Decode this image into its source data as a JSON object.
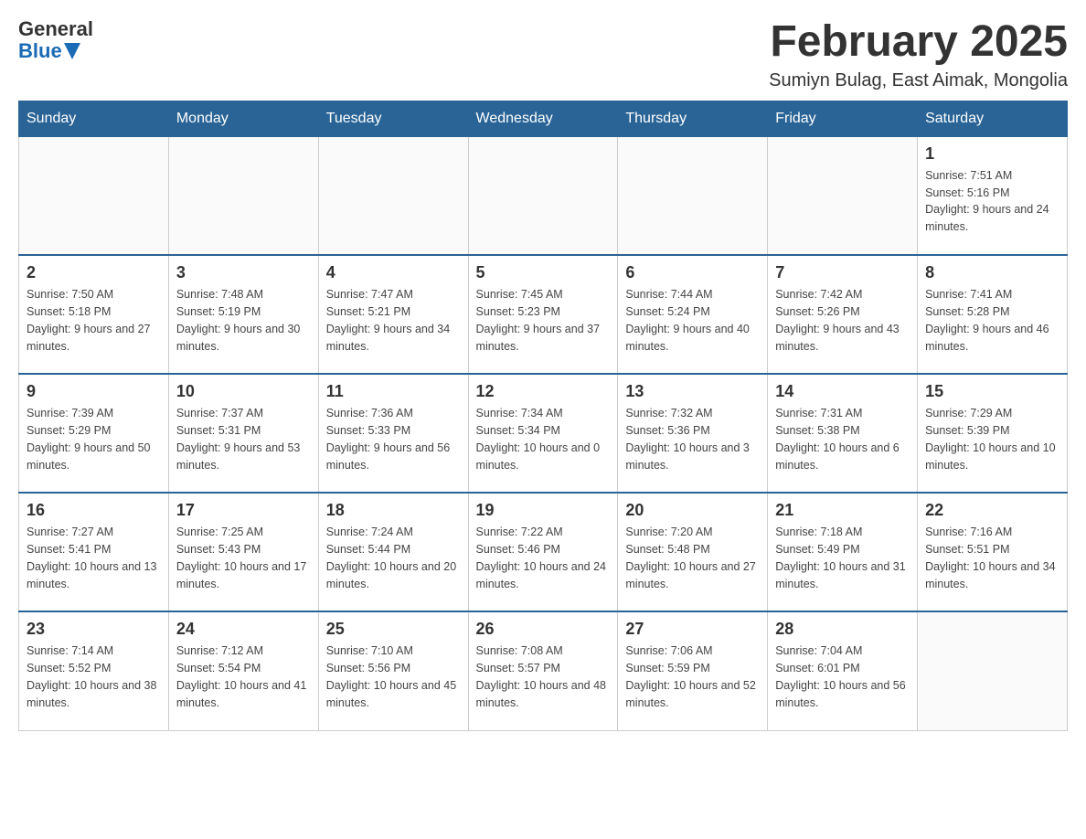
{
  "header": {
    "logo_general": "General",
    "logo_blue": "Blue",
    "title": "February 2025",
    "location": "Sumiyn Bulag, East Aimak, Mongolia"
  },
  "weekdays": [
    "Sunday",
    "Monday",
    "Tuesday",
    "Wednesday",
    "Thursday",
    "Friday",
    "Saturday"
  ],
  "weeks": [
    [
      {
        "day": "",
        "info": ""
      },
      {
        "day": "",
        "info": ""
      },
      {
        "day": "",
        "info": ""
      },
      {
        "day": "",
        "info": ""
      },
      {
        "day": "",
        "info": ""
      },
      {
        "day": "",
        "info": ""
      },
      {
        "day": "1",
        "info": "Sunrise: 7:51 AM\nSunset: 5:16 PM\nDaylight: 9 hours and 24 minutes."
      }
    ],
    [
      {
        "day": "2",
        "info": "Sunrise: 7:50 AM\nSunset: 5:18 PM\nDaylight: 9 hours and 27 minutes."
      },
      {
        "day": "3",
        "info": "Sunrise: 7:48 AM\nSunset: 5:19 PM\nDaylight: 9 hours and 30 minutes."
      },
      {
        "day": "4",
        "info": "Sunrise: 7:47 AM\nSunset: 5:21 PM\nDaylight: 9 hours and 34 minutes."
      },
      {
        "day": "5",
        "info": "Sunrise: 7:45 AM\nSunset: 5:23 PM\nDaylight: 9 hours and 37 minutes."
      },
      {
        "day": "6",
        "info": "Sunrise: 7:44 AM\nSunset: 5:24 PM\nDaylight: 9 hours and 40 minutes."
      },
      {
        "day": "7",
        "info": "Sunrise: 7:42 AM\nSunset: 5:26 PM\nDaylight: 9 hours and 43 minutes."
      },
      {
        "day": "8",
        "info": "Sunrise: 7:41 AM\nSunset: 5:28 PM\nDaylight: 9 hours and 46 minutes."
      }
    ],
    [
      {
        "day": "9",
        "info": "Sunrise: 7:39 AM\nSunset: 5:29 PM\nDaylight: 9 hours and 50 minutes."
      },
      {
        "day": "10",
        "info": "Sunrise: 7:37 AM\nSunset: 5:31 PM\nDaylight: 9 hours and 53 minutes."
      },
      {
        "day": "11",
        "info": "Sunrise: 7:36 AM\nSunset: 5:33 PM\nDaylight: 9 hours and 56 minutes."
      },
      {
        "day": "12",
        "info": "Sunrise: 7:34 AM\nSunset: 5:34 PM\nDaylight: 10 hours and 0 minutes."
      },
      {
        "day": "13",
        "info": "Sunrise: 7:32 AM\nSunset: 5:36 PM\nDaylight: 10 hours and 3 minutes."
      },
      {
        "day": "14",
        "info": "Sunrise: 7:31 AM\nSunset: 5:38 PM\nDaylight: 10 hours and 6 minutes."
      },
      {
        "day": "15",
        "info": "Sunrise: 7:29 AM\nSunset: 5:39 PM\nDaylight: 10 hours and 10 minutes."
      }
    ],
    [
      {
        "day": "16",
        "info": "Sunrise: 7:27 AM\nSunset: 5:41 PM\nDaylight: 10 hours and 13 minutes."
      },
      {
        "day": "17",
        "info": "Sunrise: 7:25 AM\nSunset: 5:43 PM\nDaylight: 10 hours and 17 minutes."
      },
      {
        "day": "18",
        "info": "Sunrise: 7:24 AM\nSunset: 5:44 PM\nDaylight: 10 hours and 20 minutes."
      },
      {
        "day": "19",
        "info": "Sunrise: 7:22 AM\nSunset: 5:46 PM\nDaylight: 10 hours and 24 minutes."
      },
      {
        "day": "20",
        "info": "Sunrise: 7:20 AM\nSunset: 5:48 PM\nDaylight: 10 hours and 27 minutes."
      },
      {
        "day": "21",
        "info": "Sunrise: 7:18 AM\nSunset: 5:49 PM\nDaylight: 10 hours and 31 minutes."
      },
      {
        "day": "22",
        "info": "Sunrise: 7:16 AM\nSunset: 5:51 PM\nDaylight: 10 hours and 34 minutes."
      }
    ],
    [
      {
        "day": "23",
        "info": "Sunrise: 7:14 AM\nSunset: 5:52 PM\nDaylight: 10 hours and 38 minutes."
      },
      {
        "day": "24",
        "info": "Sunrise: 7:12 AM\nSunset: 5:54 PM\nDaylight: 10 hours and 41 minutes."
      },
      {
        "day": "25",
        "info": "Sunrise: 7:10 AM\nSunset: 5:56 PM\nDaylight: 10 hours and 45 minutes."
      },
      {
        "day": "26",
        "info": "Sunrise: 7:08 AM\nSunset: 5:57 PM\nDaylight: 10 hours and 48 minutes."
      },
      {
        "day": "27",
        "info": "Sunrise: 7:06 AM\nSunset: 5:59 PM\nDaylight: 10 hours and 52 minutes."
      },
      {
        "day": "28",
        "info": "Sunrise: 7:04 AM\nSunset: 6:01 PM\nDaylight: 10 hours and 56 minutes."
      },
      {
        "day": "",
        "info": ""
      }
    ]
  ]
}
